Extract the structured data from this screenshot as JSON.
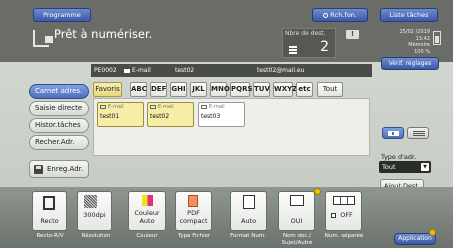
{
  "header": {
    "program_label": "Programme",
    "search_label": "Rch.fon.",
    "joblist_label": "Liste tâches",
    "title": "Prêt à numériser.",
    "dest_count_label": "Nbre de dest.",
    "dest_count": "2",
    "date": "25/02 /2019",
    "time": "13:42",
    "memory_label": "Mémoire",
    "memory_value": "100 %",
    "verify_label": "Vérif. réglages"
  },
  "address_info": {
    "code": "PE0002",
    "type": "E-mail",
    "name": "test02",
    "email": "test02@mail.eu"
  },
  "sidebar": {
    "items": [
      {
        "label": "Carnet adres.",
        "selected": true
      },
      {
        "label": "Saisie directe",
        "selected": false
      },
      {
        "label": "Histor.tâches",
        "selected": false
      },
      {
        "label": "Recher.Adr.",
        "selected": false
      }
    ],
    "register_label": "Enreg.Adr."
  },
  "index_tabs": {
    "favorites": "Favoris",
    "letters": [
      "ABC",
      "DEF",
      "GHI",
      "JKL",
      "MNO",
      "PQRS",
      "TUV",
      "WXYZ",
      "etc"
    ],
    "all": "Tout"
  },
  "address_cards": [
    {
      "type": "E-mail",
      "name": "test01",
      "selected": true
    },
    {
      "type": "E-mail",
      "name": "test02",
      "selected": true
    },
    {
      "type": "E-mail",
      "name": "test03",
      "selected": false
    }
  ],
  "right_panel": {
    "address_type_label": "Type d'adr.",
    "address_type_value": "Tout",
    "add_dest_label": "Ajout Dest."
  },
  "function_buttons": [
    {
      "value": "Recto",
      "caption": "Recto-R/V"
    },
    {
      "value": "300dpi",
      "caption": "Résolution"
    },
    {
      "value": "Couleur Auto",
      "caption": "Couleur"
    },
    {
      "value": "PDF compact",
      "caption": "Type Fichier"
    },
    {
      "value": "Auto",
      "caption": "Format Num."
    },
    {
      "value": "OUI",
      "caption": "Nom doc./ Sujet/Autre"
    },
    {
      "value": "OFF",
      "caption": "Num. séparée"
    }
  ],
  "application_label": "Application",
  "colors": {
    "accent_blue": "#4d6fba",
    "selected_yellow": "#f6eea6",
    "header_gray": "#6a6c68",
    "notice_dot": "#f2c200"
  }
}
